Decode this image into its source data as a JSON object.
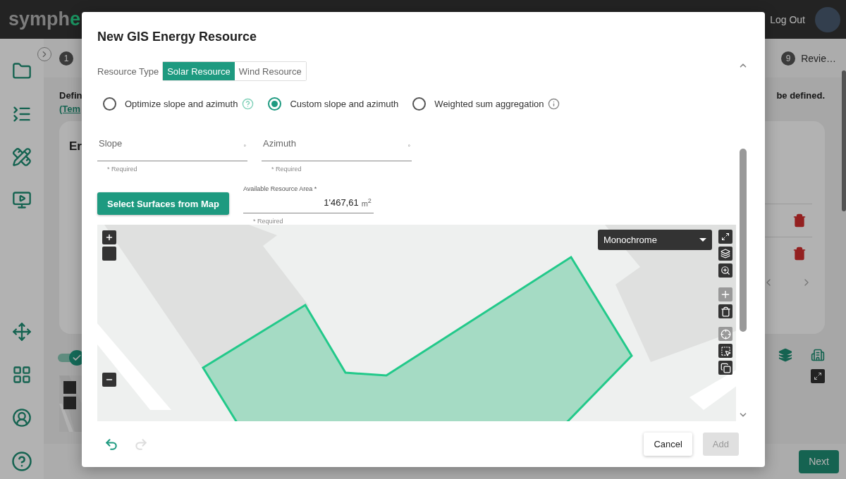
{
  "header": {
    "logo_parts": [
      {
        "text": "symph",
        "color": "#7d7d7d"
      },
      {
        "text": "e",
        "color": "#1a8f5e"
      }
    ],
    "logout_label": "Log Out"
  },
  "stepper": {
    "steps": [
      {
        "number": "1"
      },
      {
        "number": "9",
        "label": "Revie…"
      }
    ]
  },
  "background": {
    "intro_start": "Defin",
    "intro_link": "(Tem",
    "intro_end": "be defined.",
    "card_title": "Er",
    "toggle_on": true,
    "next_label": "Next"
  },
  "dialog": {
    "title": "New GIS Energy Resource",
    "resource_type": {
      "label": "Resource Type",
      "options": [
        {
          "label": "Solar Resource",
          "selected": true
        },
        {
          "label": "Wind Resource",
          "selected": false
        }
      ]
    },
    "modes": [
      {
        "label": "Optimize slope and azimuth",
        "selected": false,
        "kind": "help"
      },
      {
        "label": "Custom slope and azimuth",
        "selected": true
      },
      {
        "label": "Weighted sum aggregation",
        "selected": false,
        "kind": "info"
      }
    ],
    "fields": [
      {
        "label": "Slope",
        "unit": "°",
        "helper": "* Required"
      },
      {
        "label": "Azimuth",
        "unit": "°",
        "helper": "* Required"
      }
    ],
    "select_button": "Select Surfaces from Map",
    "area": {
      "label": "Available Resource Area *",
      "value": "1'467,61",
      "unit": "m$^{2}$",
      "helper": "* Required"
    },
    "map": {
      "basemap": "Monochrome",
      "tools": [
        {
          "kind": "add",
          "disabled": true
        },
        {
          "kind": "delete",
          "disabled": false
        },
        {
          "kind": "target",
          "disabled": true
        },
        {
          "kind": "box-select",
          "disabled": false
        },
        {
          "kind": "copy",
          "disabled": false
        }
      ]
    },
    "history": [
      {
        "kind": "undo",
        "disabled": false
      },
      {
        "kind": "redo",
        "disabled": true
      }
    ],
    "actions": [
      {
        "label": "Cancel",
        "disabled": false
      },
      {
        "label": "Add",
        "disabled": true
      }
    ]
  }
}
